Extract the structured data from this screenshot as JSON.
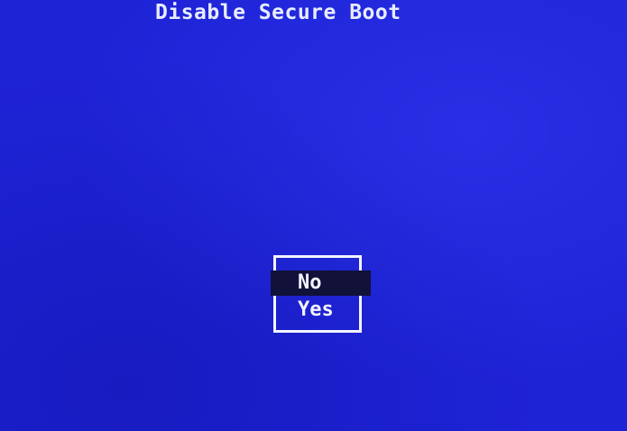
{
  "screen": {
    "title": "Disable Secure Boot"
  },
  "dialog": {
    "options": [
      {
        "label": "No",
        "selected": true
      },
      {
        "label": "Yes",
        "selected": false
      }
    ]
  },
  "colors": {
    "background": "#1e23d6",
    "text": "#f2f4ff",
    "selection_highlight": "#11113a"
  }
}
